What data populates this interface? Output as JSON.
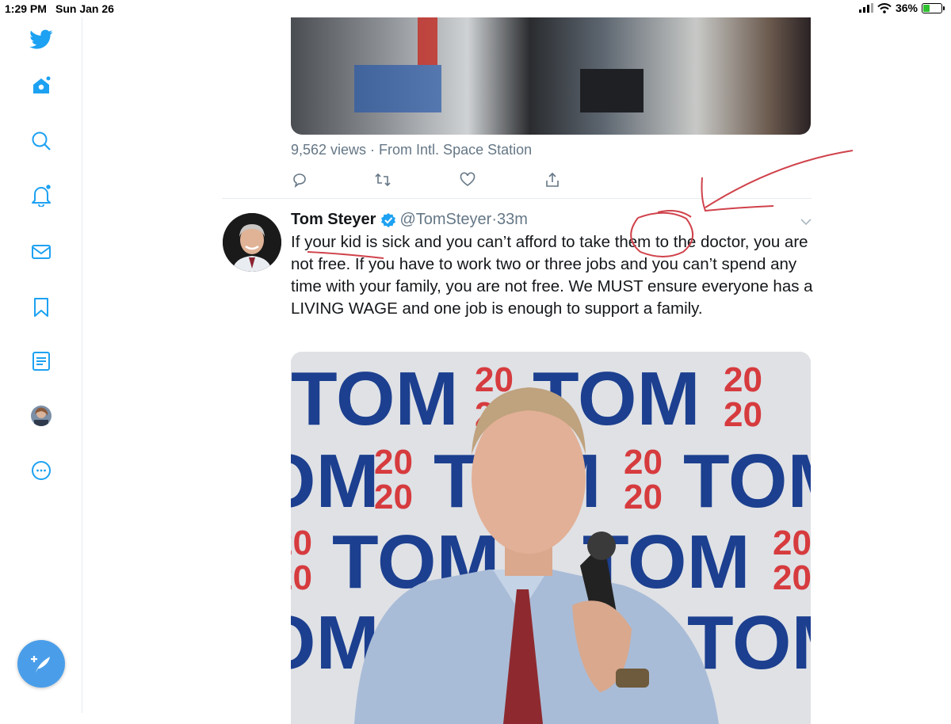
{
  "status_bar": {
    "time": "1:29 PM",
    "date": "Sun Jan 26",
    "battery": "36%",
    "battery_level": 0.36
  },
  "sidebar": {
    "items": [
      {
        "name": "twitter-logo-icon"
      },
      {
        "name": "home-icon"
      },
      {
        "name": "explore-icon"
      },
      {
        "name": "notifications-icon"
      },
      {
        "name": "messages-icon"
      },
      {
        "name": "bookmarks-icon"
      },
      {
        "name": "lists-icon"
      },
      {
        "name": "profile-avatar"
      },
      {
        "name": "more-icon"
      }
    ],
    "compose_icon": "compose-tweet-icon"
  },
  "previous_tweet": {
    "views": "9,562 views · From Intl. Space Station",
    "actions": [
      "reply-icon",
      "retweet-icon",
      "like-icon",
      "share-icon"
    ]
  },
  "tweet": {
    "author": "Tom Steyer",
    "handle": "@TomSteyer",
    "separator": "·",
    "time": "33m",
    "text": "If your kid is sick and you can’t afford to take them to the doctor, you are not free. If you have to work two or three jobs and you can’t spend any time with your family, you are not free. We MUST ensure everyone has a LIVING WAGE and one job is enough to support a family.",
    "media_banner": {
      "brand_word": "TOM",
      "year_top": "20",
      "year_bottom": "20"
    }
  },
  "colors": {
    "accent": "#1da1f2",
    "fab": "#4a9ee9",
    "annotation": "#d0424b",
    "banner_navy": "#1c3f8f",
    "banner_red": "#d63b3e"
  }
}
